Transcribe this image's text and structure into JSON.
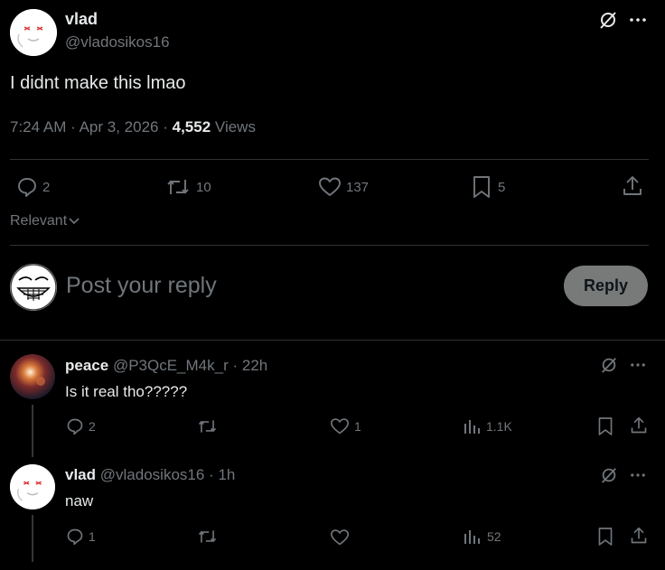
{
  "main_post": {
    "display_name": "vlad",
    "handle": "@vladosikos16",
    "text": "I didnt make this lmao",
    "time": "7:24 AM",
    "date": "Apr 3, 2026",
    "views_count": "4,552",
    "views_label": "Views",
    "replies": "2",
    "reposts": "10",
    "likes": "137",
    "bookmarks": "5"
  },
  "sort": {
    "label": "Relevant"
  },
  "composer": {
    "placeholder": "Post your reply",
    "button_label": "Reply"
  },
  "replies": [
    {
      "display_name": "peace",
      "handle": "@P3QcE_M4k_r",
      "age": "22h",
      "text": "Is it real tho?????",
      "replies": "2",
      "reposts": "",
      "likes": "1",
      "views": "1.1K"
    },
    {
      "display_name": "vlad",
      "handle": "@vladosikos16",
      "age": "1h",
      "text": "naw",
      "replies": "1",
      "reposts": "",
      "likes": "",
      "views": "52"
    }
  ],
  "colors": {
    "background": "#000000",
    "text": "#e7e9ea",
    "muted": "#71767b",
    "divider": "#2f3336",
    "reply_button": "#787a7a"
  },
  "icons": [
    "grok-icon",
    "more-icon",
    "reply-icon",
    "repost-icon",
    "like-icon",
    "bookmark-icon",
    "share-icon",
    "views-icon",
    "chevron-down-icon"
  ]
}
